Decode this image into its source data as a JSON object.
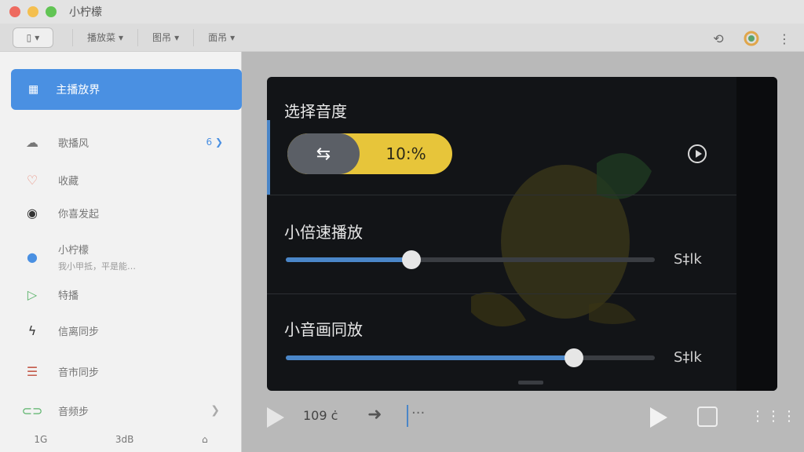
{
  "app": {
    "title": "小柠檬"
  },
  "toolbar": {
    "home_label": "",
    "menus": [
      "播放菜",
      "图吊",
      "面吊"
    ],
    "icons": [
      "share-icon",
      "color-wheel-icon",
      "more-icon"
    ]
  },
  "sidebar": {
    "active": {
      "label": "主播放界"
    },
    "items": [
      {
        "label": "歌播风",
        "badge": "6",
        "icon": "cloud-icon"
      },
      {
        "label": "收藏",
        "icon": "heart-icon"
      },
      {
        "label": "你喜发起",
        "icon": "record-icon"
      },
      {
        "label": "小柠檬",
        "sub": "我小甲抵，平是能…",
        "icon": "play-icon"
      },
      {
        "label": "特播",
        "icon": "triangle-icon"
      },
      {
        "label": "信离同步",
        "icon": "bolt-icon"
      },
      {
        "label": "音市同步",
        "icon": "list-icon"
      },
      {
        "label": "音频步",
        "icon": "toggle-icon"
      }
    ],
    "footer": [
      "1G",
      "3dB",
      ""
    ]
  },
  "panel": {
    "sections": [
      {
        "title": "选择音度",
        "toggle_value": "10:%",
        "toggle_icon": "swap-icon"
      },
      {
        "title": "小倍速播放",
        "slider_value": 0.34,
        "value_label": "S‡lk"
      },
      {
        "title": "小音画同放",
        "slider_value": 0.78,
        "value_label": "S‡lk"
      }
    ]
  },
  "bottom": {
    "time": "109 ċ",
    "arrow": "➜",
    "dots": "···",
    "grid": "⋮⋮⋮"
  },
  "colors": {
    "accent": "#4a86c8",
    "toggle_yellow": "#e7c53a",
    "sidebar_active": "#4a90e2",
    "panel_bg": "#121417"
  }
}
